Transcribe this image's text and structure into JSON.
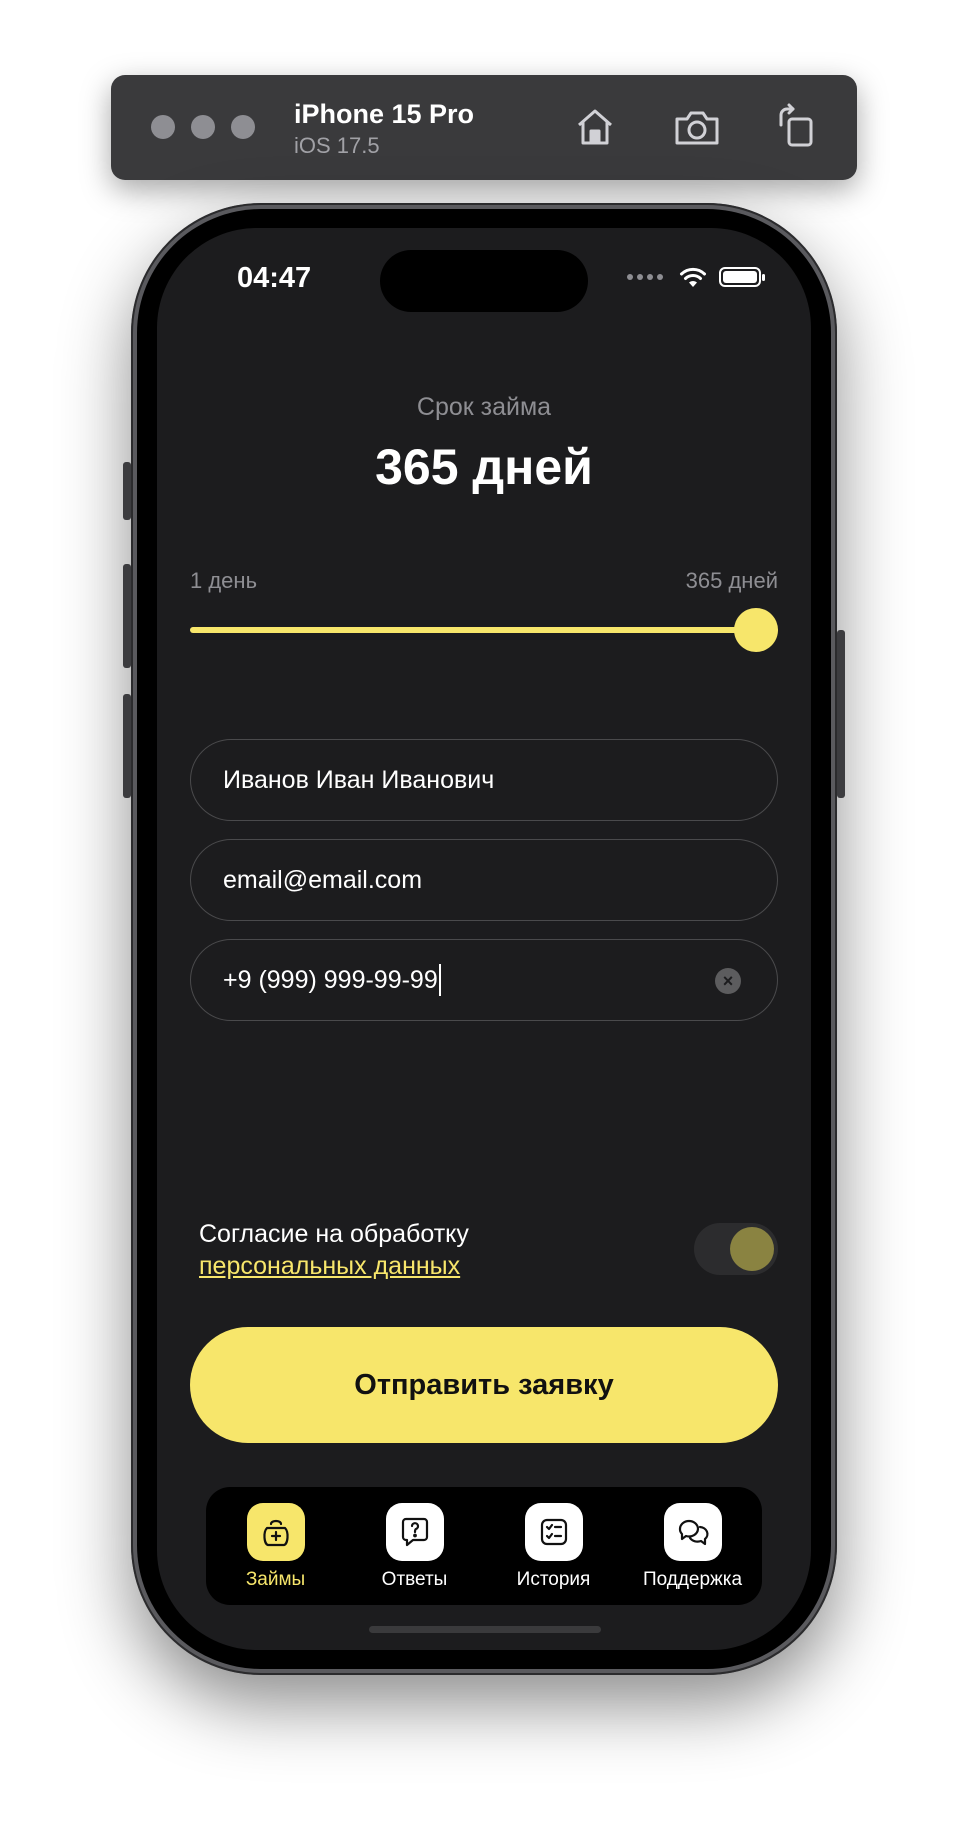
{
  "simulator": {
    "device_name": "iPhone 15 Pro",
    "os_version": "iOS 17.5",
    "icons": [
      "home-icon",
      "screenshot-icon",
      "rotate-icon"
    ]
  },
  "status_bar": {
    "time": "04:47",
    "icons": [
      "signal-icon",
      "wifi-icon",
      "battery-icon"
    ]
  },
  "loan_term": {
    "label": "Срок займа",
    "value": "365 дней",
    "min_label": "1 день",
    "max_label": "365 дней",
    "slider_value": 365,
    "slider_min": 1,
    "slider_max": 365
  },
  "form": {
    "name_value": "Иванов Иван Иванович",
    "email_value": "email@email.com",
    "phone_value": "+9 (999) 999-99-99"
  },
  "consent": {
    "text": "Согласие на обработку",
    "link": "персональных данных",
    "toggle_on": true
  },
  "submit": {
    "label": "Отправить заявку"
  },
  "tabs": [
    {
      "label": "Займы",
      "icon": "loan-bag-icon",
      "active": true
    },
    {
      "label": "Ответы",
      "icon": "question-bubble-icon",
      "active": false
    },
    {
      "label": "История",
      "icon": "checklist-icon",
      "active": false
    },
    {
      "label": "Поддержка",
      "icon": "support-chat-icon",
      "active": false
    }
  ],
  "colors": {
    "accent": "#F7E66B",
    "background": "#1C1C1E",
    "muted_text": "#8E8E93"
  }
}
